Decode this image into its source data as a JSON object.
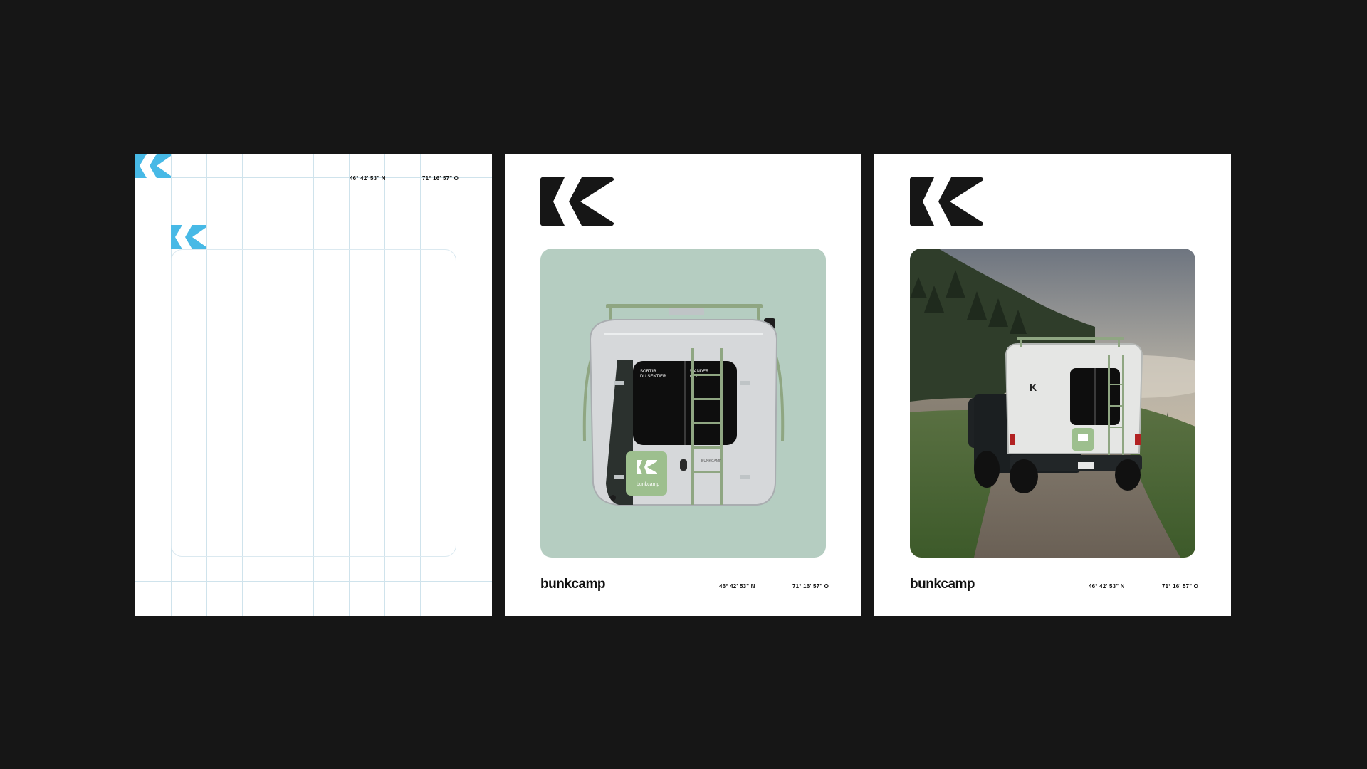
{
  "brand": {
    "wordmark": "bunkcamp",
    "colors": {
      "background": "#161616",
      "poster": "#ffffff",
      "mark_blue": "#47b9e6",
      "mark_black": "#161616",
      "sage_panel": "#b5cdc1",
      "grid_line": "#cfe3ec"
    }
  },
  "coordinates": {
    "latitude": "46° 42' 53\" N",
    "longitude": "71° 16' 57\" O"
  },
  "posters": [
    {
      "kind": "grid-template",
      "logo_icon": "k-logo-icon"
    },
    {
      "kind": "van-rear-mockup",
      "logo_icon": "k-logo-icon",
      "image_icon": "camper-rear-illustration"
    },
    {
      "kind": "landscape-photo",
      "logo_icon": "k-logo-icon",
      "image_icon": "camper-truck-mountain-photo"
    }
  ],
  "van_decals": {
    "left_text": "SORTIR DU SENTIER",
    "right_text": "WANDER OFF",
    "plate_text": "BUNKCAMP",
    "badge_wordmark": "bunkcamp"
  }
}
